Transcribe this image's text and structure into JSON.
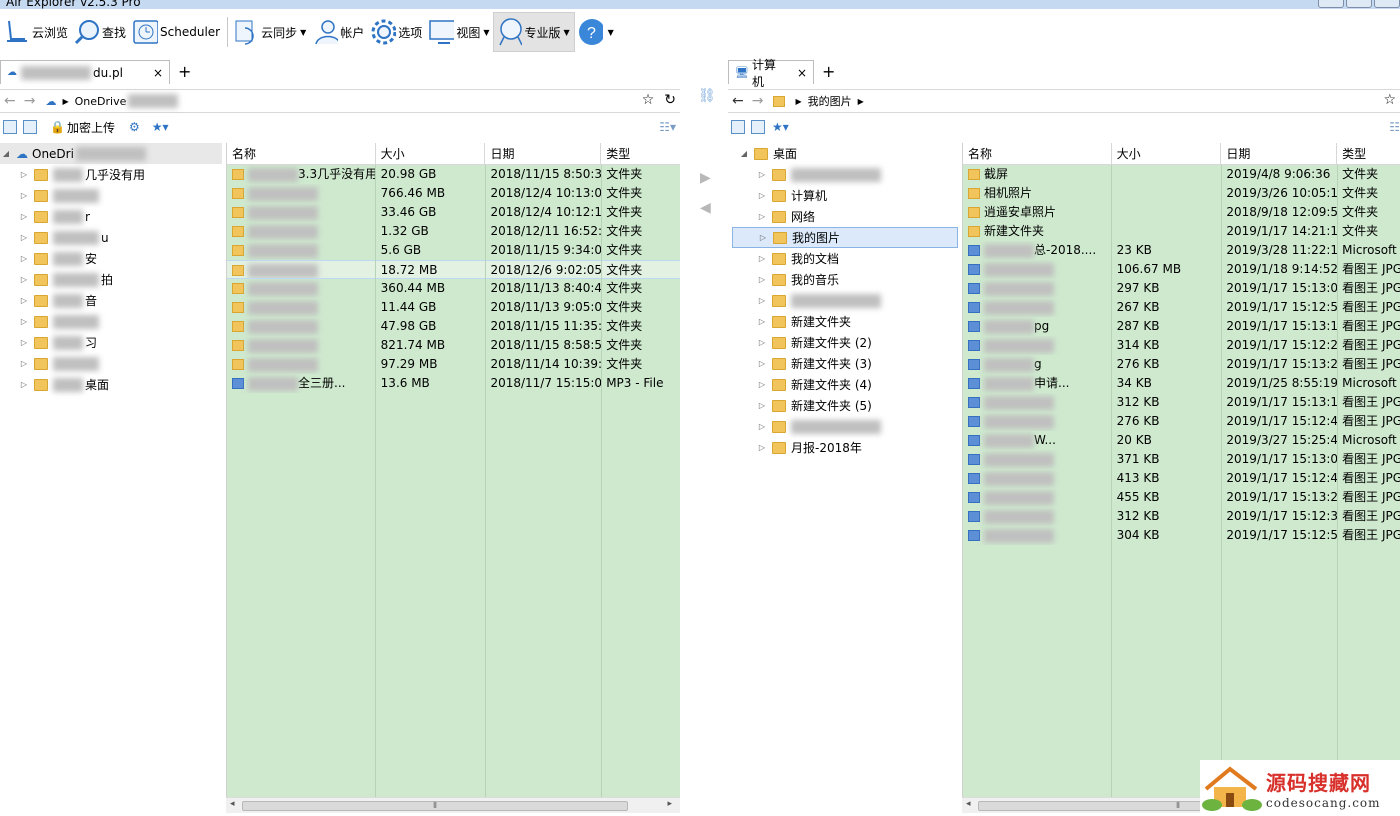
{
  "window": {
    "title": "Air Explorer v2.5.3 Pro"
  },
  "toolbar": {
    "browse": "云浏览",
    "find": "查找",
    "scheduler": "Scheduler",
    "sync": "云同步",
    "accounts": "帐户",
    "options": "选项",
    "view": "视图",
    "pro": "专业版"
  },
  "left": {
    "tab_label": "du.pl",
    "tab_close": "×",
    "tab_add": "+",
    "path_root": "OneDrive",
    "upload_encrypted": "加密上传",
    "tree_root": "OneDri",
    "tree": [
      "几乎没有用",
      "",
      "r",
      "u",
      "安",
      "拍",
      "音",
      "",
      "习",
      "",
      "桌面"
    ],
    "columns": [
      "名称",
      "大小",
      "日期",
      "类型"
    ],
    "rows": [
      {
        "name": "3.3几乎没有用",
        "size": "20.98 GB",
        "date": "2018/11/15 8:50:33",
        "type": "文件夹"
      },
      {
        "name": "",
        "size": "766.46 MB",
        "date": "2018/12/4 10:13:02",
        "type": "文件夹"
      },
      {
        "name": "",
        "size": "33.46 GB",
        "date": "2018/12/4 10:12:13",
        "type": "文件夹"
      },
      {
        "name": "",
        "size": "1.32 GB",
        "date": "2018/12/11 16:52:...",
        "type": "文件夹"
      },
      {
        "name": "",
        "size": "5.6 GB",
        "date": "2018/11/15 9:34:08",
        "type": "文件夹"
      },
      {
        "name": "",
        "size": "18.72 MB",
        "date": "2018/12/6 9:02:05",
        "type": "文件夹"
      },
      {
        "name": "",
        "size": "360.44 MB",
        "date": "2018/11/13 8:40:40",
        "type": "文件夹"
      },
      {
        "name": "",
        "size": "11.44 GB",
        "date": "2018/11/13 9:05:07",
        "type": "文件夹"
      },
      {
        "name": "",
        "size": "47.98 GB",
        "date": "2018/11/15 11:35:...",
        "type": "文件夹"
      },
      {
        "name": "",
        "size": "821.74 MB",
        "date": "2018/11/15 8:58:51",
        "type": "文件夹"
      },
      {
        "name": "",
        "size": "97.29 MB",
        "date": "2018/11/14 10:39:...",
        "type": "文件夹"
      },
      {
        "name": "全三册...",
        "size": "13.6 MB",
        "date": "2018/11/7 15:15:00",
        "type": "MP3 - File"
      }
    ]
  },
  "right": {
    "tab_label": "计算机",
    "tab_close": "×",
    "tab_add": "+",
    "path_folder": "我的图片",
    "tree": [
      "桌面",
      "",
      "计算机",
      "网络",
      "我的图片",
      "我的文档",
      "我的音乐",
      "",
      "新建文件夹",
      "新建文件夹 (2)",
      "新建文件夹 (3)",
      "新建文件夹 (4)",
      "新建文件夹 (5)",
      "",
      "月报-2018年"
    ],
    "columns": [
      "名称",
      "大小",
      "日期",
      "类型"
    ],
    "rows": [
      {
        "name": "截屏",
        "size": "",
        "date": "2019/4/8 9:06:36",
        "type": "文件夹"
      },
      {
        "name": "相机照片",
        "size": "",
        "date": "2019/3/26 10:05:10",
        "type": "文件夹"
      },
      {
        "name": "逍遥安卓照片",
        "size": "",
        "date": "2018/9/18 12:09:55",
        "type": "文件夹"
      },
      {
        "name": "新建文件夹",
        "size": "",
        "date": "2019/1/17 14:21:17",
        "type": "文件夹"
      },
      {
        "name": "总-2018....",
        "size": "23 KB",
        "date": "2019/3/28 11:22:17",
        "type": "Microsoft W"
      },
      {
        "name": "",
        "size": "106.67 MB",
        "date": "2019/1/18 9:14:52",
        "type": "看图王 JPG"
      },
      {
        "name": "",
        "size": "297 KB",
        "date": "2019/1/17 15:13:00",
        "type": "看图王 JPG"
      },
      {
        "name": "",
        "size": "267 KB",
        "date": "2019/1/17 15:12:56",
        "type": "看图王 JPG"
      },
      {
        "name": "pg",
        "size": "287 KB",
        "date": "2019/1/17 15:13:11",
        "type": "看图王 JPG"
      },
      {
        "name": "",
        "size": "314 KB",
        "date": "2019/1/17 15:12:20",
        "type": "看图王 JPG"
      },
      {
        "name": "g",
        "size": "276 KB",
        "date": "2019/1/17 15:13:20",
        "type": "看图王 JPG"
      },
      {
        "name": "申请...",
        "size": "34 KB",
        "date": "2019/1/25 8:55:19",
        "type": "Microsoft W"
      },
      {
        "name": "",
        "size": "312 KB",
        "date": "2019/1/17 15:13:15",
        "type": "看图王 JPG"
      },
      {
        "name": "",
        "size": "276 KB",
        "date": "2019/1/17 15:12:40",
        "type": "看图王 JPG"
      },
      {
        "name": "W...",
        "size": "20 KB",
        "date": "2019/3/27 15:25:42",
        "type": "Microsoft W"
      },
      {
        "name": "",
        "size": "371 KB",
        "date": "2019/1/17 15:13:04",
        "type": "看图王 JPG"
      },
      {
        "name": "",
        "size": "413 KB",
        "date": "2019/1/17 15:12:46",
        "type": "看图王 JPG"
      },
      {
        "name": "",
        "size": "455 KB",
        "date": "2019/1/17 15:13:24",
        "type": "看图王 JPG"
      },
      {
        "name": "",
        "size": "312 KB",
        "date": "2019/1/17 15:12:36",
        "type": "看图王 JPG"
      },
      {
        "name": "",
        "size": "304 KB",
        "date": "2019/1/17 15:12:50",
        "type": "看图王 JPG"
      }
    ]
  },
  "watermark": {
    "title": "源码搜藏网",
    "url": "codesocang.com"
  },
  "colors": {
    "list_bg": "#cfe9cf",
    "accent": "#2f74c4",
    "selection": "#dbe9fa"
  }
}
